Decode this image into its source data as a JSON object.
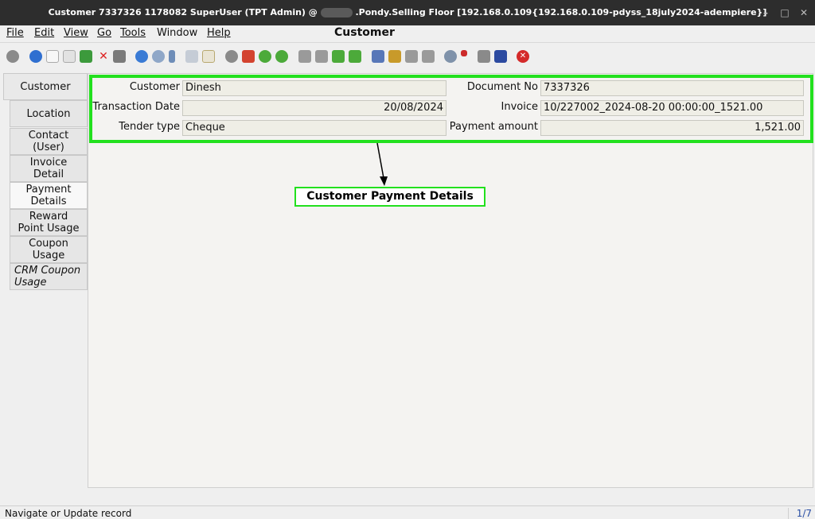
{
  "titlebar": {
    "title_left": "Customer  7337326  1178082  SuperUser (TPT Admin) @",
    "title_right": ".Pondy.Selling Floor [192.168.0.109{192.168.0.109-pdyss_18july2024-adempiere}]"
  },
  "menu": {
    "file": "File",
    "edit": "Edit",
    "view": "View",
    "go": "Go",
    "tools": "Tools",
    "window": "Window",
    "help": "Help"
  },
  "window_heading": "Customer",
  "tabs": [
    {
      "label": "Customer"
    },
    {
      "label": "Location"
    },
    {
      "label": "Contact (User)"
    },
    {
      "label": "Invoice Detail"
    },
    {
      "label": "Payment Details"
    },
    {
      "label": "Reward Point Usage"
    },
    {
      "label": "Coupon Usage"
    },
    {
      "label": "CRM Coupon Usage"
    }
  ],
  "form": {
    "customer_label": "Customer",
    "customer_value": "Dinesh",
    "document_no_label": "Document No",
    "document_no_value": "7337326",
    "transaction_date_label": "Transaction Date",
    "transaction_date_value": "20/08/2024",
    "invoice_label": "Invoice",
    "invoice_value": "10/227002_2024-08-20 00:00:00_1521.00",
    "tender_type_label": "Tender type",
    "tender_type_value": "Cheque",
    "payment_amount_label": "Payment amount",
    "payment_amount_value": "1,521.00"
  },
  "annotation": "Customer Payment Details",
  "status": {
    "message": "Navigate or Update record",
    "page": "1/7"
  },
  "colors": {
    "highlight": "#22e01e",
    "titlebar": "#2d2d2d"
  }
}
